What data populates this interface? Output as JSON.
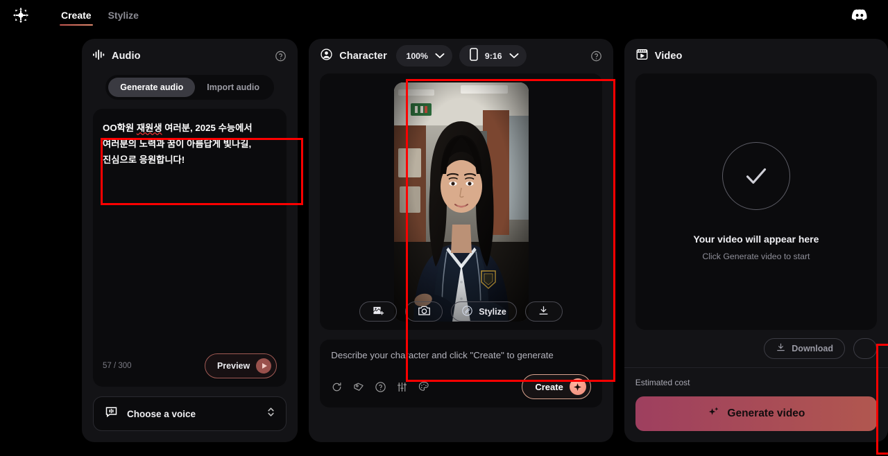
{
  "topbar": {
    "logo_icon": "snowflake-logo",
    "nav": [
      {
        "label": "Create",
        "active": true
      },
      {
        "label": "Stylize",
        "active": false
      }
    ],
    "discord_icon": "discord-icon"
  },
  "audio_panel": {
    "icon": "waveform-icon",
    "title": "Audio",
    "help_icon": "help-circle-icon",
    "tabs": [
      {
        "label": "Generate audio",
        "active": true
      },
      {
        "label": "Import audio",
        "active": false
      }
    ],
    "script_text": "OO학원 재원생 여러분, 2025 수능에서 여러분의 노력과 꿈이 아름답게 빛나길, 진심으로 응원합니다!",
    "script_line1_a": "OO학원 ",
    "script_line1_misspelled": "재원생",
    "script_line1_b": " 여러분, 2025 수능에서 여러분의 노력과 꿈이 아름답게 빛나길, 진심으로 응원합니다!",
    "counter": "57 / 300",
    "preview_label": "Preview",
    "preview_icon": "play-icon",
    "voice_icon": "voice-chat-icon",
    "voice_label": "Choose a voice",
    "voice_chevron_icon": "chevron-updown-icon"
  },
  "character_panel": {
    "icon": "user-circle-icon",
    "title": "Character",
    "help_icon": "help-circle-icon",
    "zoom_value": "100%",
    "zoom_chevron_icon": "chevron-down-icon",
    "aspect_icon": "phone-icon",
    "aspect_value": "9:16",
    "aspect_chevron_icon": "chevron-down-icon",
    "tools": [
      {
        "name": "add-image",
        "icon": "image-plus-icon",
        "label": ""
      },
      {
        "name": "camera",
        "icon": "camera-icon",
        "label": ""
      },
      {
        "name": "stylize",
        "icon": "stylize-icon",
        "label": "Stylize"
      },
      {
        "name": "download",
        "icon": "download-icon",
        "label": ""
      }
    ],
    "prompt_placeholder": "Describe your character and click \"Create\" to generate",
    "prompt_icons": [
      "refresh-icon",
      "tag-icon",
      "help-circle-icon",
      "sliders-icon",
      "palette-icon"
    ],
    "create_label": "Create",
    "create_icon": "sparkle-icon"
  },
  "video_panel": {
    "icon": "video-clapper-icon",
    "title": "Video",
    "status_icon": "check-icon",
    "empty_title": "Your video will appear here",
    "empty_subtitle": "Click Generate video to start",
    "download_label": "Download",
    "download_icon": "download-icon",
    "cost_label": "Estimated cost",
    "generate_label": "Generate video",
    "generate_icon": "sparkles-icon"
  },
  "colors": {
    "background": "#000000",
    "panel": "#131316",
    "inner": "#0b0b0d",
    "accent": "#e08a6e",
    "annotation": "#fe0000",
    "generate_gradient_start": "#9e3f5f",
    "generate_gradient_end": "#b1574f"
  }
}
